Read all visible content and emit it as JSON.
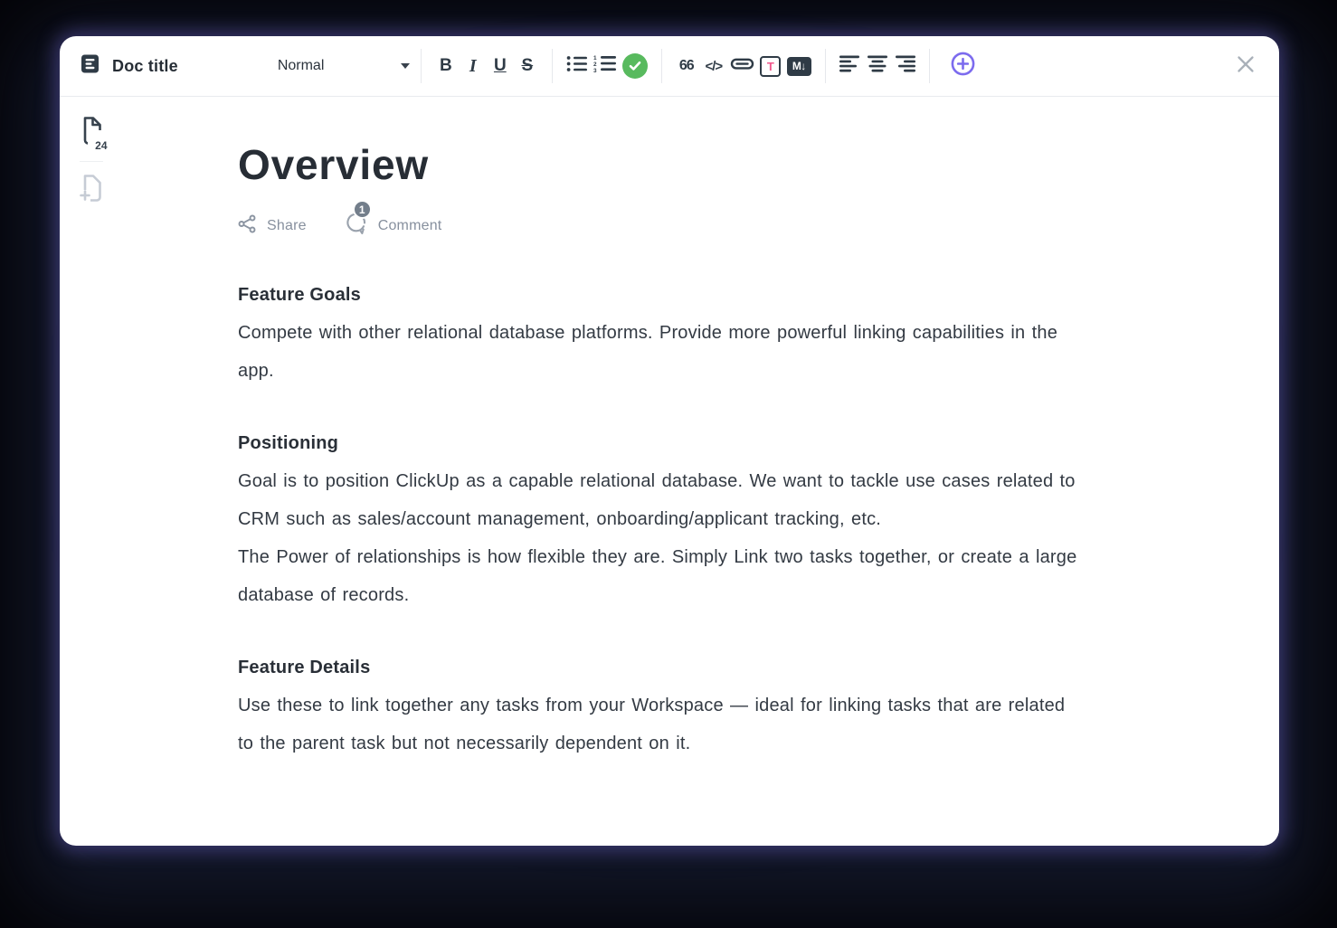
{
  "window": {
    "close_icon": "close-x"
  },
  "toolbar": {
    "doc_icon": "document",
    "doc_title": "Doc title",
    "style_selector": {
      "value": "Normal"
    },
    "format": {
      "bold": "B",
      "italic": "I",
      "underline": "U",
      "strikethrough": "S"
    },
    "insert": {
      "quote": "66",
      "code": "</>",
      "text_style_badge": "T",
      "markdown_badge": "M↓"
    },
    "icons": {
      "bullet_list": "bullet-list",
      "numbered_list": "numbered-list",
      "checklist": "green-check-circle",
      "link": "chain-link",
      "align": [
        "align-left",
        "align-center",
        "align-right"
      ],
      "add": "plus-circle-purple"
    }
  },
  "sidebar": {
    "page_count": "24",
    "pages_icon": "doc-pages",
    "add_page_icon": "add-page"
  },
  "doc": {
    "title": "Overview",
    "actions": {
      "share_label": "Share",
      "comment_label": "Comment",
      "comment_count": "1"
    },
    "sections": [
      {
        "heading": "Feature Goals",
        "paragraphs": [
          "Compete with other relational database platforms. Provide more powerful linking capabilities in the app."
        ]
      },
      {
        "heading": "Positioning",
        "paragraphs": [
          "Goal is to position ClickUp as a capable relational database. We want to tackle use cases related to CRM such as sales/account management, onboarding/applicant tracking, etc.",
          "The Power of relationships is how flexible they are. Simply Link two tasks together, or create a large database of records."
        ]
      },
      {
        "heading": "Feature Details",
        "paragraphs": [
          "Use these to link together any tasks from your Workspace — ideal for linking tasks that are related to the parent task but not necessarily dependent on it."
        ]
      }
    ]
  },
  "colors": {
    "accent_purple": "#7c6bee",
    "check_green": "#58ba5e",
    "text_style_pink": "#f2578d",
    "icon_dark": "#2f3b46",
    "label_gray": "#87909e",
    "badge_gray": "#737e8b"
  }
}
